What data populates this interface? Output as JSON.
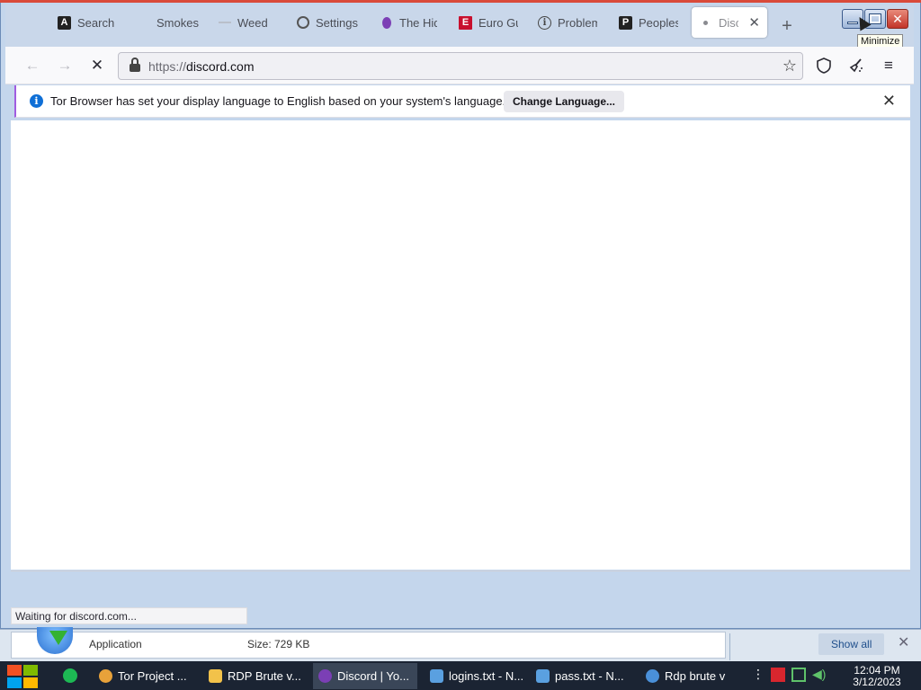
{
  "tabs": [
    {
      "label": "Search",
      "icon": "a-logo-icon"
    },
    {
      "label": "Smokes",
      "icon": "none"
    },
    {
      "label": "Weed",
      "icon": "dash-icon"
    },
    {
      "label": "Settings",
      "icon": "gear-icon"
    },
    {
      "label": "The Hid",
      "icon": "onion-icon"
    },
    {
      "label": "Euro Gu",
      "icon": "e-logo-icon"
    },
    {
      "label": "Problem",
      "icon": "info-icon"
    },
    {
      "label": "Peoples",
      "icon": "p-logo-icon"
    },
    {
      "label": "Disco",
      "icon": "loading-dot-icon",
      "active": true
    }
  ],
  "window": {
    "tooltip": "Minimize"
  },
  "navbar": {
    "url_scheme": "https://",
    "url_host": "discord.com"
  },
  "notification": {
    "message": "Tor Browser has set your display language to English based on your system's language.",
    "button_label": "Change Language..."
  },
  "status": {
    "text": "Waiting for discord.com..."
  },
  "download": {
    "type": "Application",
    "size": "Size:  729 KB",
    "show_all": "Show all"
  },
  "taskbar": {
    "items": [
      {
        "label": "Tor Project ...",
        "icon_color": "#e8a23a"
      },
      {
        "label": "RDP Brute v...",
        "icon_color": "#f2c24a"
      },
      {
        "label": "Discord | Yo...",
        "icon_color": "#7b3fb5",
        "active": true
      },
      {
        "label": "logins.txt - N...",
        "icon_color": "#5aa0e0"
      },
      {
        "label": "pass.txt - N...",
        "icon_color": "#5aa0e0"
      },
      {
        "label": "Rdp brute v",
        "icon_color": "#4a90d9"
      }
    ],
    "time": "12:04 PM",
    "date": "3/12/2023"
  },
  "colors": {
    "accent_purple": "#a05ce0",
    "info_blue": "#0f6fd6",
    "taskbar_bg": "#1b2433"
  }
}
